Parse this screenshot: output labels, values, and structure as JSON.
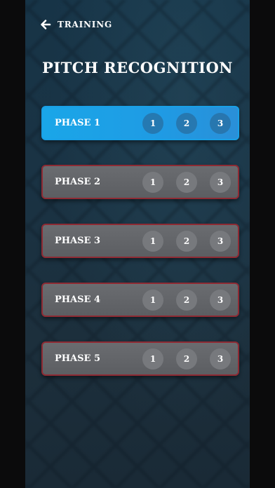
{
  "header": {
    "back_icon": "arrow-left-icon",
    "label": "TRAINING"
  },
  "title": "PITCH RECOGNITION",
  "phases": [
    {
      "label": "PHASE 1",
      "active": true,
      "levels": [
        "1",
        "2",
        "3"
      ]
    },
    {
      "label": "PHASE 2",
      "active": false,
      "levels": [
        "1",
        "2",
        "3"
      ]
    },
    {
      "label": "PHASE 3",
      "active": false,
      "levels": [
        "1",
        "2",
        "3"
      ]
    },
    {
      "label": "PHASE 4",
      "active": false,
      "levels": [
        "1",
        "2",
        "3"
      ]
    },
    {
      "label": "PHASE 5",
      "active": false,
      "levels": [
        "1",
        "2",
        "3"
      ]
    }
  ],
  "colors": {
    "active": "#1aa6e8",
    "inactive": "#616367",
    "border": "#8e2a33"
  }
}
